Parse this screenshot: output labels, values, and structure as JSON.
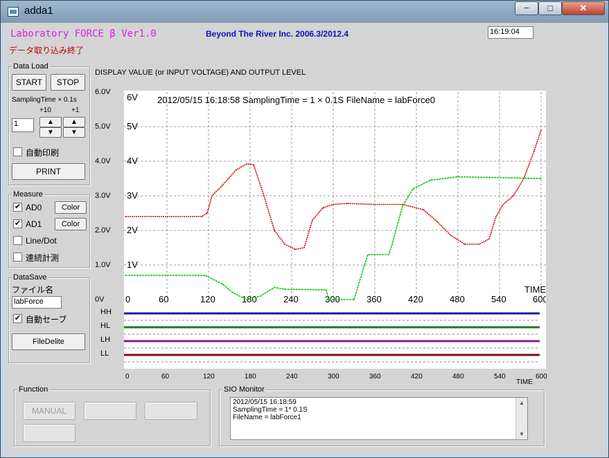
{
  "window": {
    "title": "adda1"
  },
  "header": {
    "app_title": "Laboratory FORCE β Ver1.0",
    "company": "Beyond The River  Inc. 2006.3/2012.4",
    "clock": "16:19:04",
    "status": "データ取り込み終了"
  },
  "data_load": {
    "label": "Data Load",
    "start": "START",
    "stop": "STOP",
    "sampling_label": "SamplingTime × 0.1s",
    "plus10": "+10",
    "plus1": "+1",
    "sampling_value": "1",
    "auto_print": "自動印刷",
    "print": "PRINT",
    "up_arrow": "▲",
    "down_arrow": "▼"
  },
  "measure": {
    "label": "Measure",
    "ad0": "AD0",
    "ad1": "AD1",
    "color": "Color",
    "line_dot": "Line/Dot",
    "continuous": "連続計測",
    "check": "✔"
  },
  "data_save": {
    "label": "DataSave",
    "filename_label": "ファイル名",
    "filename_value": "labForce",
    "auto_save": "自動セーブ",
    "file_delete": "FileDelite"
  },
  "function": {
    "label": "Function",
    "manual": "MANUAL"
  },
  "sio": {
    "label": "SIO Monitor",
    "line1": "2012/05/15 16:18:59",
    "line2": "SamplingTime = 1* 0.1S",
    "line3": "FileName = labForce1"
  },
  "chart_data": {
    "type": "line",
    "heading": "DISPLAY VALUE (or INPUT  VOLTAGE)  AND  OUTPUT LEVEL",
    "info": "2012/05/15 16:18:58    SamplingTime = 1 × 0.1S  FileName = labForce0",
    "y_outer_labels": [
      "6.0V",
      "5.0V",
      "4.0V",
      "3.0V",
      "2.0V",
      "1.0V",
      "0V"
    ],
    "y_inner_labels": [
      "6V",
      "5V",
      "4V",
      "3V",
      "2V",
      "1V"
    ],
    "x_ticks": [
      "0",
      "60",
      "120",
      "180",
      "240",
      "300",
      "360",
      "420",
      "480",
      "540",
      "600"
    ],
    "xlabel": "TIME",
    "ylim": [
      0,
      6
    ],
    "xlim": [
      0,
      600
    ],
    "level_labels": [
      "HH",
      "HL",
      "LH",
      "LL"
    ],
    "level_colors": [
      "#1a1ab0",
      "#1a7a1a",
      "#8a1a8a",
      "#7a1010"
    ],
    "series": [
      {
        "color": "#cc0000",
        "x": [
          0,
          110,
          118,
          125,
          140,
          160,
          175,
          185,
          200,
          215,
          230,
          245,
          258,
          270,
          285,
          300,
          320,
          360,
          400,
          430,
          450,
          470,
          490,
          510,
          525,
          535,
          545,
          560,
          575,
          590,
          600
        ],
        "y": [
          2.4,
          2.4,
          2.5,
          3.0,
          3.3,
          3.75,
          3.92,
          3.9,
          3.0,
          2.0,
          1.6,
          1.45,
          1.5,
          2.3,
          2.65,
          2.75,
          2.78,
          2.75,
          2.75,
          2.6,
          2.25,
          1.85,
          1.6,
          1.6,
          1.75,
          2.4,
          2.75,
          3.0,
          3.5,
          4.3,
          4.9
        ]
      },
      {
        "color": "#00cc00",
        "x": [
          0,
          115,
          125,
          140,
          155,
          175,
          195,
          215,
          230,
          290,
          293,
          330,
          345,
          350,
          380,
          385,
          400,
          415,
          440,
          480,
          600
        ],
        "y": [
          0.7,
          0.7,
          0.6,
          0.45,
          0.2,
          0.0,
          0.1,
          0.35,
          0.3,
          0.28,
          0.0,
          0.0,
          1.0,
          1.3,
          1.3,
          1.6,
          2.7,
          3.2,
          3.45,
          3.55,
          3.5
        ]
      }
    ]
  }
}
